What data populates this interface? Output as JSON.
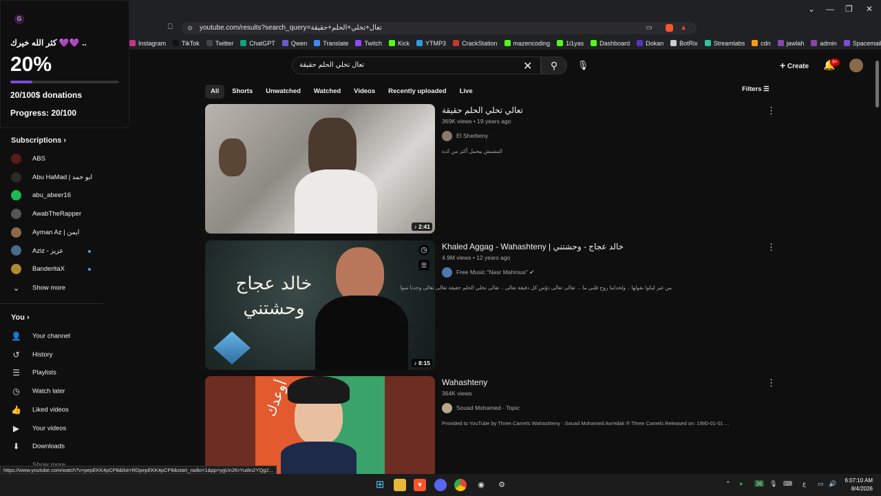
{
  "browser": {
    "url": "youtube.com/results?search_query=تعال+تخلي+الحلم+حقيقة",
    "window_controls": [
      "⌄",
      "—",
      "❐",
      "✕"
    ],
    "bookmarks": [
      {
        "label": "Instagram",
        "color": "#c13584"
      },
      {
        "label": "TikTok",
        "color": "#111111"
      },
      {
        "label": "Twitter",
        "color": "#444444"
      },
      {
        "label": "ChatGPT",
        "color": "#10a37f"
      },
      {
        "label": "Qwen",
        "color": "#6a5acd"
      },
      {
        "label": "Translate",
        "color": "#4285f4"
      },
      {
        "label": "Twitch",
        "color": "#9146ff"
      },
      {
        "label": "Kick",
        "color": "#53fc18"
      },
      {
        "label": "YTMP3",
        "color": "#2d9cdb"
      },
      {
        "label": "CrackStation",
        "color": "#c0392b"
      },
      {
        "label": "mazencoding",
        "color": "#53fc18"
      },
      {
        "label": "1i1yas",
        "color": "#53fc18"
      },
      {
        "label": "Dashboard",
        "color": "#53fc18"
      },
      {
        "label": "Dokan",
        "color": "#5b2fc4"
      },
      {
        "label": "BotRix",
        "color": "#cccccc"
      },
      {
        "label": "Streamlabs",
        "color": "#31c3a2"
      },
      {
        "label": "cdn",
        "color": "#f39c12"
      },
      {
        "label": "jawlah",
        "color": "#8e44ad"
      },
      {
        "label": "admin",
        "color": "#8e44ad"
      },
      {
        "label": "Spacemail",
        "color": "#7b4dd6"
      }
    ]
  },
  "donation": {
    "message": "كثر الله خيرك 💜💜 ..",
    "percent_label": "20%",
    "progress_fraction": 0.2,
    "amount": "20/100$ donations",
    "progress_text": "Progress: 20/100"
  },
  "sidebar": {
    "subscriptions_title": "Subscriptions",
    "subscriptions": [
      {
        "label": "ABS",
        "color": "#5a1a1a",
        "dot": false
      },
      {
        "label": "Abu HaMad | ابو حمد",
        "color": "#2a2a2a",
        "dot": false
      },
      {
        "label": "abu_abeer16",
        "color": "#1db954",
        "dot": false
      },
      {
        "label": "AwabTheRapper",
        "color": "#555555",
        "dot": false
      },
      {
        "label": "Ayman Az | ايمن",
        "color": "#8a6a4a",
        "dot": false
      },
      {
        "label": "Aziz - عزيز",
        "color": "#4a6a8a",
        "dot": true
      },
      {
        "label": "BanderitaX",
        "color": "#b08a30",
        "dot": true
      }
    ],
    "show_more": "Show more",
    "you_title": "You",
    "you_items": [
      {
        "label": "Your channel",
        "icon": "👤"
      },
      {
        "label": "History",
        "icon": "↺"
      },
      {
        "label": "Playlists",
        "icon": "☰"
      },
      {
        "label": "Watch later",
        "icon": "◷"
      },
      {
        "label": "Liked videos",
        "icon": "👍"
      },
      {
        "label": "Your videos",
        "icon": "▶"
      },
      {
        "label": "Downloads",
        "icon": "⬇"
      }
    ],
    "show_more_2": "Show more"
  },
  "header": {
    "search_value": "تعال تخلي الحلم حقيقة",
    "create_label": "Create",
    "notif_badge": "9+"
  },
  "chips": [
    "All",
    "Shorts",
    "Unwatched",
    "Watched",
    "Videos",
    "Recently uploaded",
    "Live"
  ],
  "filters_label": "Filters",
  "results": [
    {
      "title": "تعالي تخلي الحلم حقيقة",
      "meta": "369K views • 19 years ago",
      "channel": "El Sherbeny",
      "description": "المشيش بيحمل أكثر من كده",
      "duration": "♪ 2:41"
    },
    {
      "title": "Khaled Aggag - Wahashteny | خالد عجاج - وحشتني",
      "meta": "4.9M views • 12 years ago",
      "channel": "Free Music \"Nasr Mahrous\" ✔",
      "description": "من غير ليكوا بقولها .. ولحداينا روح قلبي ما ... تعالى تعالى دوّس كل دقيقة تعالى .. تعالى تخلي الحلم حقيقة تعالى تعالى وحدنا سوا",
      "duration": "♪ 8:15",
      "thumb_text": "خالد عجاج\nوحشتني"
    },
    {
      "title": "Wahashteny",
      "meta": "364K views",
      "channel": "Souad Mohamed - Topic",
      "description": "Provided to YouTube by Three Camels Wahashteny · Souad Mohamed Aw'edak ℗ Three Camels Released on: 1980-01-01 ...",
      "thumb_text": "أوعدك"
    }
  ],
  "status_url": "https://www.youtube.com/watch?v=pepEKK4pCP8&list=RDpepEKK4pCP8&start_radio=1&pp=ygUn2KrYudin2YQg2...",
  "taskbar": {
    "time": "6:07:10 AM",
    "date": "8/4/2026",
    "tray_badge": "36",
    "lang": "ع"
  }
}
